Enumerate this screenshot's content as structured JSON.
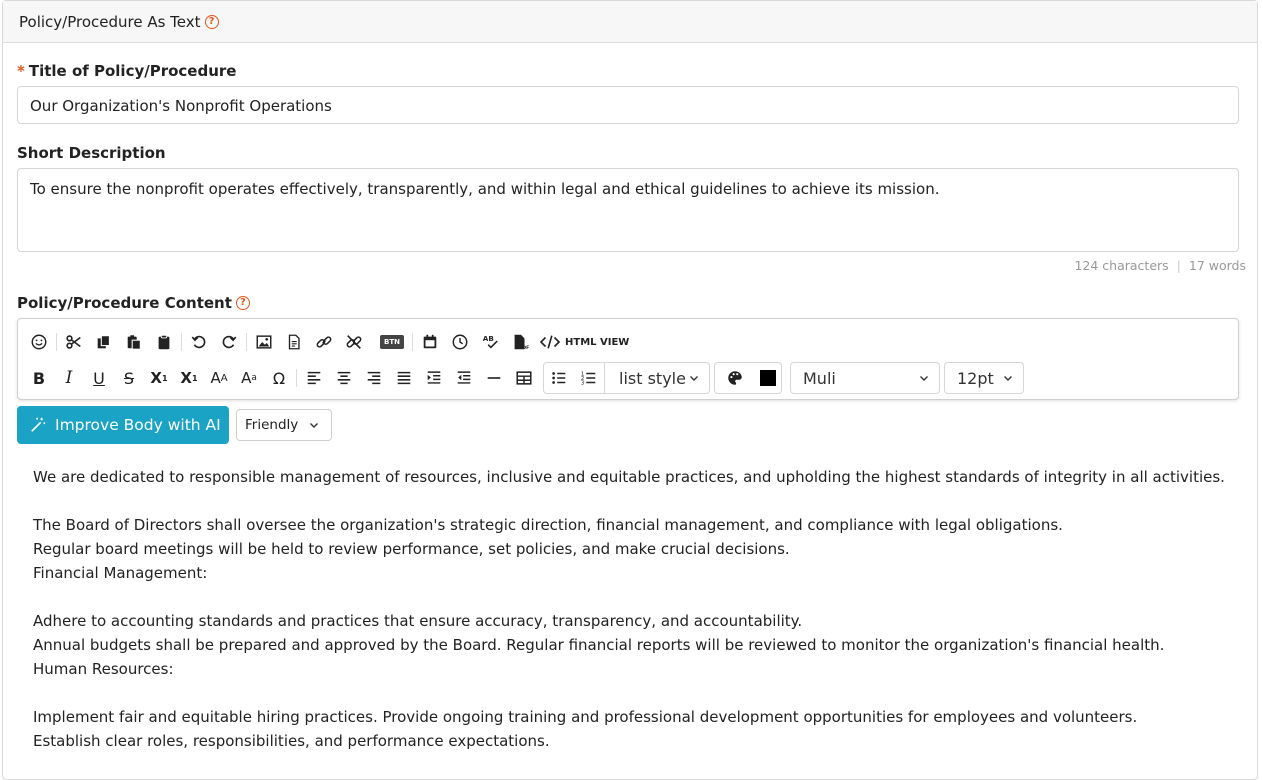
{
  "section": {
    "title": "Policy/Procedure As Text"
  },
  "title_field": {
    "label": "Title of Policy/Procedure",
    "required_mark": "*",
    "value": "Our Organization's Nonprofit Operations"
  },
  "description_field": {
    "label": "Short Description",
    "value": "To ensure the nonprofit operates effectively, transparently, and within legal and ethical guidelines to achieve its mission.",
    "char_count": "124 characters",
    "word_count": "17 words"
  },
  "content_field": {
    "label": "Policy/Procedure Content"
  },
  "toolbar": {
    "row1": [
      "emoji-icon",
      "cut-icon",
      "copy-icon",
      "paste-icon",
      "paste-text-icon",
      "undo-icon",
      "redo-icon",
      "image-icon",
      "document-icon",
      "link-icon",
      "unlink-icon",
      "button-icon",
      "calendar-icon",
      "clock-icon",
      "spellcheck-icon",
      "pdf-icon",
      "code-icon"
    ],
    "btn_badge": "BTN",
    "html_view": "HTML VIEW",
    "list_style": "list style",
    "font_family": "Muli",
    "font_size": "12pt",
    "text_color": "#000000"
  },
  "ai": {
    "improve_label": "Improve Body with AI",
    "tone": "Friendly",
    "accent": "#1aa3c4"
  },
  "body_lines": [
    "We are dedicated to responsible management of resources, inclusive and equitable practices, and upholding the highest standards of integrity in all activities.",
    "",
    "The Board of Directors shall oversee the organization's strategic direction, financial management, and compliance with legal obligations.",
    "Regular board meetings will be held to review performance, set policies, and make crucial decisions.",
    "Financial Management:",
    "",
    "Adhere to accounting standards and practices that ensure accuracy, transparency, and accountability.",
    "Annual budgets shall be prepared and approved by the Board. Regular financial reports will be reviewed to monitor the organization's financial health.",
    "Human Resources:",
    "",
    "Implement fair and equitable hiring practices. Provide ongoing training and professional development opportunities for employees and volunteers.",
    "Establish clear roles, responsibilities, and performance expectations."
  ]
}
